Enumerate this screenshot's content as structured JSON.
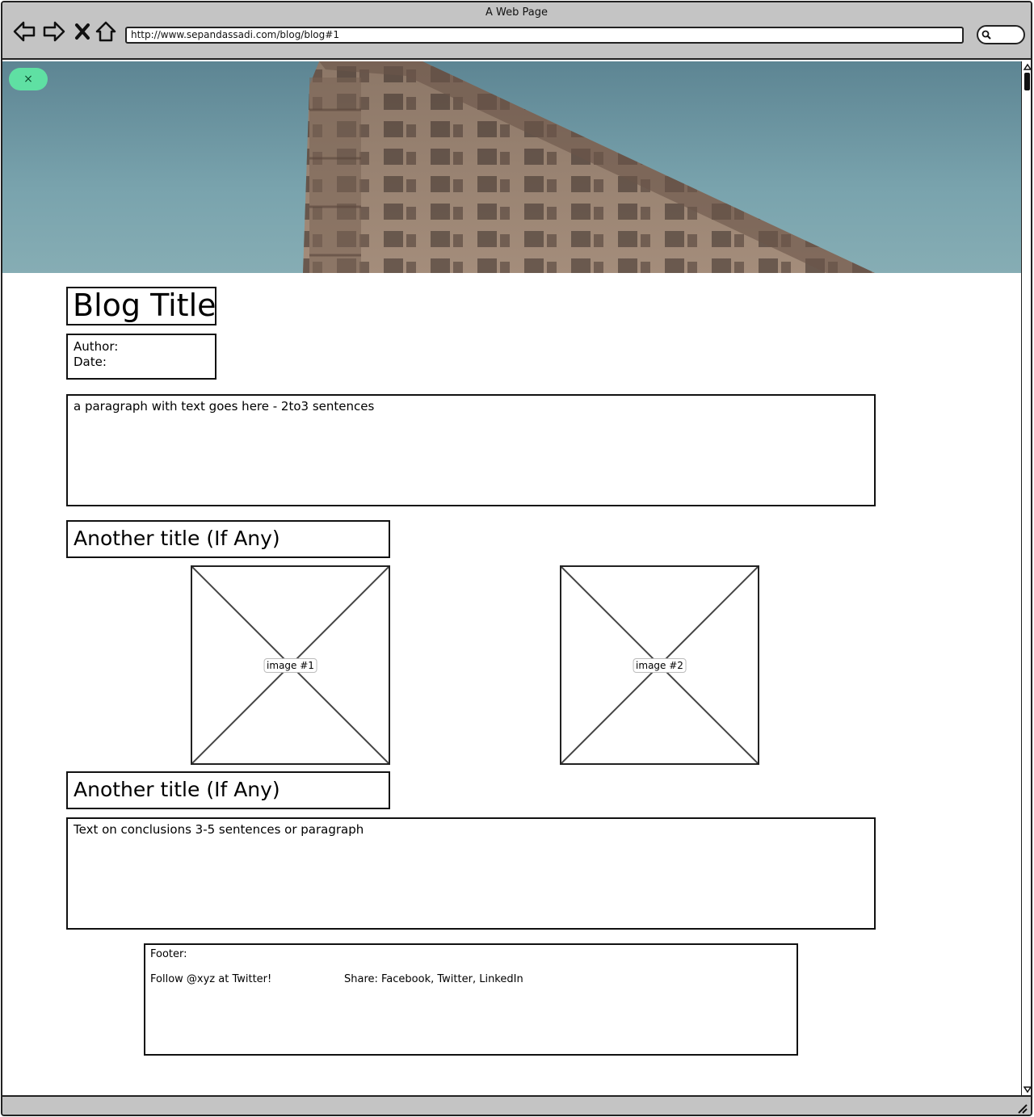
{
  "window": {
    "title": "A Web Page",
    "url": "http://www.sepandassadi.com/blog/blog#1"
  },
  "icons": {
    "back": "back-arrow-icon",
    "forward": "forward-arrow-icon",
    "stop": "close-x-icon",
    "home": "home-icon",
    "search": "search-icon",
    "dismiss": "close-x-icon"
  },
  "hero": {
    "dismiss_label": "×"
  },
  "blog": {
    "title": "Blog Title",
    "author_label": "Author:",
    "date_label": "Date:",
    "intro_paragraph": "a paragraph with text goes here - 2to3 sentences",
    "section_title_1": "Another title (If Any)",
    "image_1_label": "image #1",
    "image_2_label": "image #2",
    "section_title_2": "Another title (If Any)",
    "conclusion": "Text on conclusions 3-5 sentences or paragraph"
  },
  "footer": {
    "heading": "Footer:",
    "follow": "Follow @xyz at Twitter!",
    "share": "Share: Facebook, Twitter, LinkedIn"
  },
  "colors": {
    "chrome": "#c4c4c4",
    "dismiss_pill": "#5fe0a3",
    "sky": "#79a3ad"
  }
}
